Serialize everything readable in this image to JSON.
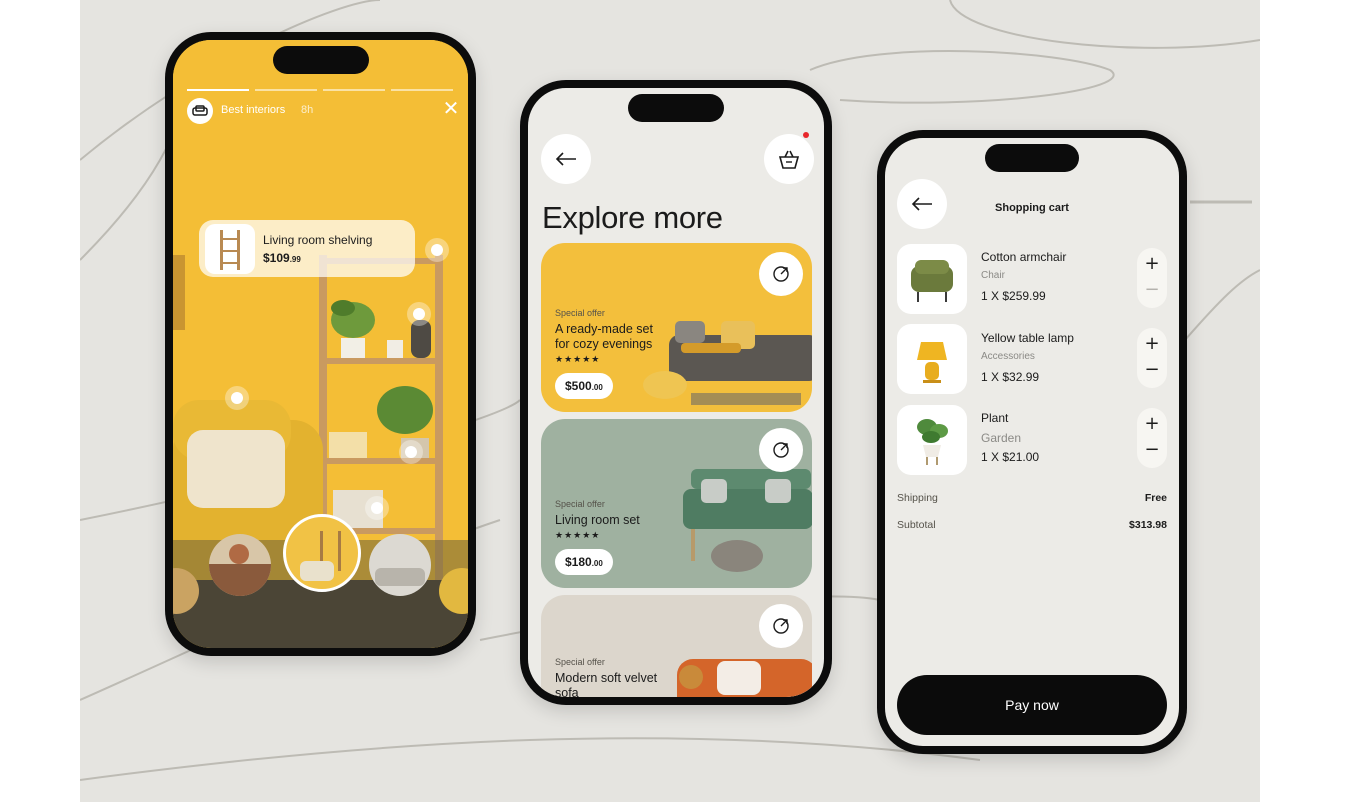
{
  "colors": {
    "accent_yellow": "#f4be36",
    "sage": "#9fb1a0",
    "dark": "#0b0b0b",
    "background": "#e5e4e0"
  },
  "story": {
    "account_name": "Best interiors",
    "time": "8h",
    "product_title": "Living room shelving",
    "product_price_main": "$109",
    "product_price_cents": ".99",
    "close_icon": "close-icon"
  },
  "explore": {
    "heading": "Explore more",
    "cards": [
      {
        "kicker": "Special offer",
        "title_line1": "A ready-made set",
        "title_line2": "for cozy evenings",
        "stars": "★★★★★",
        "price_main": "$500",
        "price_cents": ".00"
      },
      {
        "kicker": "Special offer",
        "title_line1": "Living room set",
        "stars": "★★★★★",
        "price_main": "$180",
        "price_cents": ".00"
      },
      {
        "kicker": "Special offer",
        "title_line1": "Modern soft velvet",
        "title_line2": "sofa"
      }
    ]
  },
  "cart": {
    "title": "Shopping cart",
    "items": [
      {
        "name": "Cotton armchair",
        "category": "Chair",
        "qty_price": "1 X $259.99"
      },
      {
        "name": "Yellow table lamp",
        "category": "Accessories",
        "qty_price": "1 X $32.99"
      },
      {
        "name": "Plant",
        "category": "Garden",
        "qty_price": "1 X $21.00"
      }
    ],
    "shipping_label": "Shipping",
    "shipping_value": "Free",
    "subtotal_label": "Subtotal",
    "subtotal_value": "$313.98",
    "pay_label": "Pay now"
  }
}
